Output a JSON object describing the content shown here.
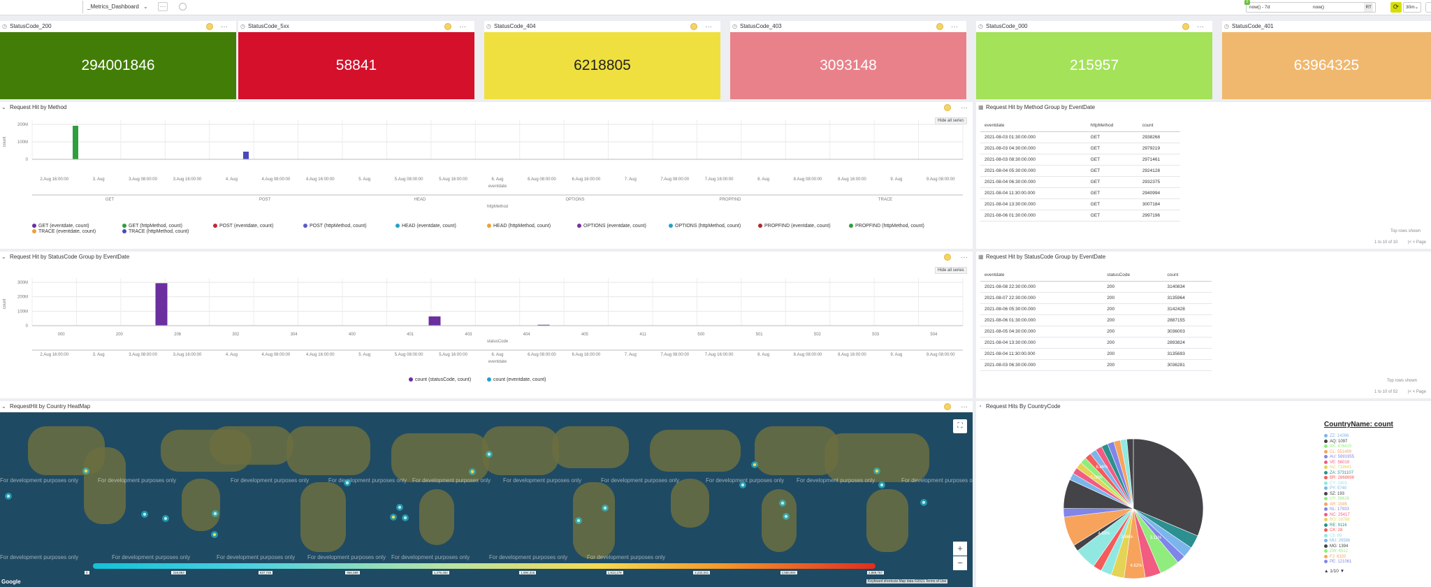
{
  "header": {
    "dashboard_title": "_Metrics_Dashboard",
    "time_from": "now() - 7d",
    "time_to": "now()",
    "rt_label": "RT",
    "refresh_interval": "30m",
    "notification_count": "0"
  },
  "stats": [
    {
      "title": "StatusCode_200",
      "value": "294001846",
      "bg": "#427e07",
      "fg": "#ffffff"
    },
    {
      "title": "StatusCode_5xx",
      "value": "58841",
      "bg": "#d4102b",
      "fg": "#ffffff"
    },
    {
      "title": "StatusCode_404",
      "value": "6218805",
      "bg": "#efe040",
      "fg": "#222222"
    },
    {
      "title": "StatusCode_403",
      "value": "3093148",
      "bg": "#e9818a",
      "fg": "#ffffff"
    },
    {
      "title": "StatusCode_000",
      "value": "215957",
      "bg": "#a4e259",
      "fg": "#ffffff"
    },
    {
      "title": "StatusCode_401",
      "value": "63964325",
      "bg": "#f0b86e",
      "fg": "#ffffff"
    }
  ],
  "method_chart": {
    "title": "Request Hit by Method",
    "hide_all": "Hide all series",
    "y_label": "count",
    "x_label": "eventdate",
    "x2_label": "httpMethod",
    "y_ticks": [
      "200M",
      "100M",
      "0"
    ],
    "x_ticks": [
      "2.Aug 16:00:00",
      "3. Aug",
      "3.Aug 08:00:00",
      "3.Aug 16:00:00",
      "4. Aug",
      "4.Aug 08:00:00",
      "4.Aug 16:00:00",
      "5. Aug",
      "5.Aug 08:00:00",
      "5.Aug 16:00:00",
      "6. Aug",
      "6.Aug 08:00:00",
      "6.Aug 16:00:00",
      "7. Aug",
      "7.Aug 08:00:00",
      "7.Aug 16:00:00",
      "8. Aug",
      "8.Aug 08:00:00",
      "8.Aug 16:00:00",
      "9. Aug",
      "9.Aug 08:00:00"
    ],
    "x2_ticks": [
      "GET",
      "POST",
      "HEAD",
      "OPTIONS",
      "PROPFIND",
      "TRACE"
    ],
    "legend": [
      {
        "label": "GET (eventdate, count)",
        "color": "#6b2fa0"
      },
      {
        "label": "TRACE (eventdate, count)",
        "color": "#f0a030"
      },
      {
        "label": "GET (httpMethod, count)",
        "color": "#2e9e3e"
      },
      {
        "label": "TRACE (httpMethod, count)",
        "color": "#4b49b8"
      },
      {
        "label": "POST (eventdate, count)",
        "color": "#c0283a"
      },
      {
        "label": "POST (httpMethod, count)",
        "color": "#5a5ac8"
      },
      {
        "label": "HEAD (eventdate, count)",
        "color": "#26a0c8"
      },
      {
        "label": "HEAD (httpMethod, count)",
        "color": "#f0a030"
      },
      {
        "label": "OPTIONS (eventdate, count)",
        "color": "#7a2fa0"
      },
      {
        "label": "OPTIONS (httpMethod, count)",
        "color": "#26a0c8"
      },
      {
        "label": "PROPFIND (eventdate, count)",
        "color": "#b02a2a"
      },
      {
        "label": "PROPFIND (httpMethod, count)",
        "color": "#2e9e3e"
      }
    ]
  },
  "status_chart": {
    "title": "Request Hit by StatusCode Group by EventDate",
    "hide_all": "Hide all series",
    "y_label": "count",
    "x_label": "eventdate",
    "x2_label": "statusCode",
    "y_ticks": [
      "300M",
      "200M",
      "100M",
      "0"
    ],
    "x2_ticks": [
      "000",
      "200",
      "206",
      "302",
      "304",
      "400",
      "401",
      "403",
      "404",
      "405",
      "411",
      "500",
      "501",
      "502",
      "503",
      "504"
    ],
    "x_ticks": [
      "2.Aug 16:00:00",
      "3. Aug",
      "3.Aug 08:00:00",
      "3.Aug 16:00:00",
      "4. Aug",
      "4.Aug 08:00:00",
      "4.Aug 16:00:00",
      "5. Aug",
      "5.Aug 08:00:00",
      "5.Aug 16:00:00",
      "6. Aug",
      "6.Aug 08:00:00",
      "6.Aug 16:00:00",
      "7. Aug",
      "7.Aug 08:00:00",
      "7.Aug 16:00:00",
      "8. Aug",
      "8.Aug 08:00:00",
      "8.Aug 16:00:00",
      "9. Aug",
      "9.Aug 08:00:00"
    ],
    "legend": [
      {
        "label": "count (statusCode, count)",
        "color": "#6b2fa0"
      },
      {
        "label": "count (eventdate, count)",
        "color": "#26a0c8"
      }
    ]
  },
  "chart_data": [
    {
      "type": "bar",
      "title": "Request Hit by Method",
      "xlabel": "httpMethod",
      "ylabel": "count",
      "ylim": [
        0,
        250000000
      ],
      "categories": [
        "GET",
        "POST"
      ],
      "series": [
        {
          "name": "GET (httpMethod, count)",
          "values": [
            240000000,
            0
          ]
        },
        {
          "name": "POST (httpMethod, count)",
          "values": [
            0,
            55000000
          ]
        }
      ]
    },
    {
      "type": "bar",
      "title": "Request Hit by StatusCode Group by EventDate",
      "xlabel": "statusCode",
      "ylabel": "count",
      "ylim": [
        0,
        300000000
      ],
      "categories": [
        "200",
        "401",
        "404"
      ],
      "values": [
        294000000,
        64000000,
        6200000
      ]
    },
    {
      "type": "pie",
      "title": "Request Hits By CountryCode",
      "slice_labels": [
        "31.36%",
        "6.76%",
        "6.86%",
        "5.08%",
        "4.62%",
        "4.89%",
        "3.66%",
        "3.11%"
      ],
      "values": [
        31.36,
        6.76,
        6.86,
        5.08,
        4.62,
        4.89,
        3.66,
        3.11
      ]
    }
  ],
  "method_table": {
    "title": "Request Hit by Method Group by EventDate",
    "columns": [
      "eventdate",
      "httpMethod",
      "count"
    ],
    "rows": [
      [
        "2021-08-03 01:30:00.000",
        "GET",
        "2938268"
      ],
      [
        "2021-08-03 04:30:00.000",
        "GET",
        "2979219"
      ],
      [
        "2021-08-03 08:30:00.000",
        "GET",
        "2971461"
      ],
      [
        "2021-08-04 05:30:00.000",
        "GET",
        "2924128"
      ],
      [
        "2021-08-04 06:30:00.000",
        "GET",
        "2932375"
      ],
      [
        "2021-08-04 11:30:00.000",
        "GET",
        "2940994"
      ],
      [
        "2021-08-04 13:30:00.000",
        "GET",
        "3007184"
      ],
      [
        "2021-08-06 01:30:00.000",
        "GET",
        "2997196"
      ]
    ],
    "footer_left": "1 to 10 of 10",
    "footer_right": "Top rows shown",
    "pager": "Page"
  },
  "status_table": {
    "title": "Request Hit by StatusCode Group by EventDate",
    "columns": [
      "eventdate",
      "statusCode",
      "count"
    ],
    "rows": [
      [
        "2021-08-08 22:30:00.000",
        "200",
        "3140834"
      ],
      [
        "2021-08-07 22:30:00.000",
        "200",
        "3135964"
      ],
      [
        "2021-08-06 05:30:00.000",
        "200",
        "3142428"
      ],
      [
        "2021-08-06 01:30:00.000",
        "200",
        "2887155"
      ],
      [
        "2021-08-05 04:30:00.000",
        "200",
        "3036003"
      ],
      [
        "2021-08-04 13:30:00.000",
        "200",
        "2893824"
      ],
      [
        "2021-08-04 11:30:00.000",
        "200",
        "3135693"
      ],
      [
        "2021-08-03 06:30:00.000",
        "200",
        "3036281"
      ]
    ],
    "footer_left": "1 to 10 of 52",
    "footer_right": "Top rows shown",
    "pager": "Page"
  },
  "map": {
    "title": "RequestHit by Country HeatMap",
    "watermark": "For development purposes only",
    "zoom_in": "+",
    "zoom_out": "−",
    "attribution": "Keyboard shortcuts   Map data ©2021   Terms of Use",
    "google": "Google",
    "scale_ticks": [
      "0",
      "318,863",
      "637,726",
      "956,589",
      "1,275,452",
      "1,594,315",
      "1,913,178",
      "2,232,041",
      "2,550,904",
      "2,869,767"
    ]
  },
  "pie": {
    "title": "Request Hits By CountryCode",
    "legend_title": "CountryName: count",
    "legend": [
      {
        "label": "ZZ: 14266",
        "color": "#7cb5ec"
      },
      {
        "label": "AQ: 1097",
        "color": "#434348"
      },
      {
        "label": "XK: 476415",
        "color": "#90ed7d"
      },
      {
        "label": "CL: 551499",
        "color": "#f7a35c"
      },
      {
        "label": "AU: 5891955",
        "color": "#8085e9"
      },
      {
        "label": "VE: 56019",
        "color": "#f15c80"
      },
      {
        "label": "NZ: 719641",
        "color": "#e4d354"
      },
      {
        "label": "ZA: 3731107",
        "color": "#2b908f"
      },
      {
        "label": "BR: 2868896",
        "color": "#f45b5b"
      },
      {
        "label": "CY: 1403",
        "color": "#91e8e1"
      },
      {
        "label": "PY: 5740",
        "color": "#7cb5ec"
      },
      {
        "label": "SZ: 193",
        "color": "#434348"
      },
      {
        "label": "UY: 38626",
        "color": "#90ed7d"
      },
      {
        "label": "AR: 1585",
        "color": "#f7a35c"
      },
      {
        "label": "NL: 17933",
        "color": "#8085e9"
      },
      {
        "label": "NC: 25417",
        "color": "#f15c80"
      },
      {
        "label": "BO: 16786",
        "color": "#e4d354"
      },
      {
        "label": "RE: 9116",
        "color": "#2b908f"
      },
      {
        "label": "CK: 28",
        "color": "#f45b5b"
      },
      {
        "label": "LS: 69",
        "color": "#91e8e1"
      },
      {
        "label": "MU: 26586",
        "color": "#7cb5ec"
      },
      {
        "label": "MG: 1394",
        "color": "#434348"
      },
      {
        "label": "ZW: 4512",
        "color": "#90ed7d"
      },
      {
        "label": "FJ: 6320",
        "color": "#f7a35c"
      },
      {
        "label": "PE: 121061",
        "color": "#8085e9"
      }
    ],
    "pager": "1/10"
  }
}
